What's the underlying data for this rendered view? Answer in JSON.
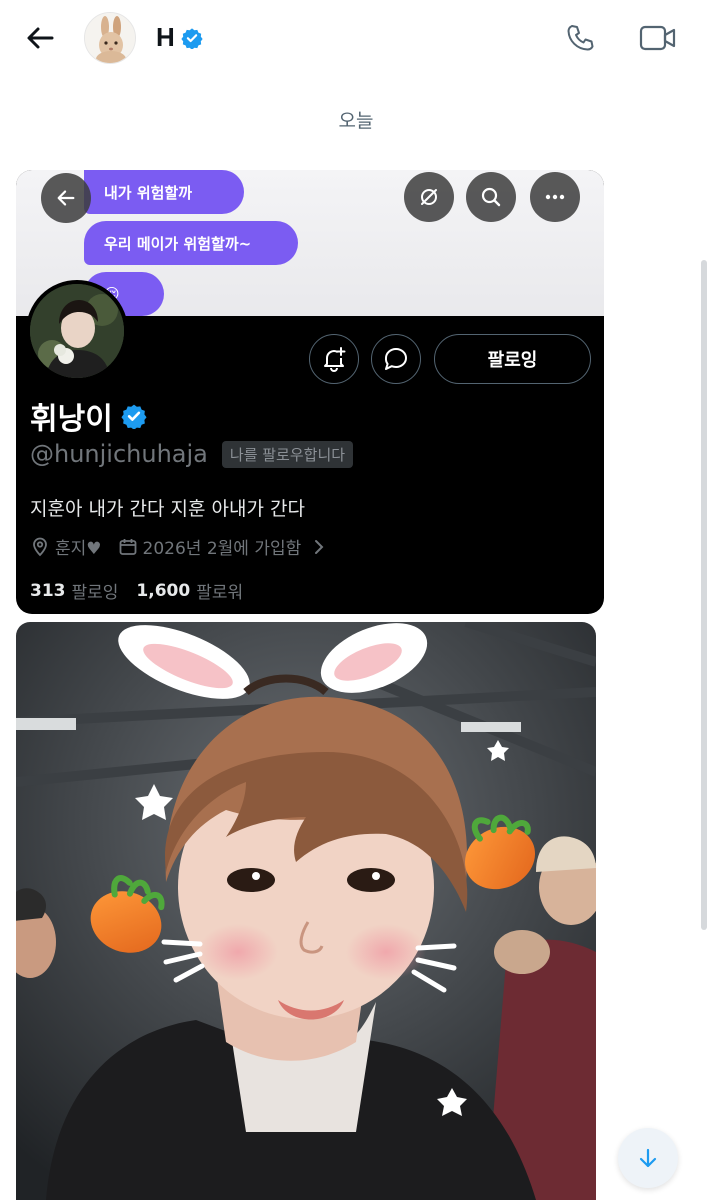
{
  "header": {
    "name": "H",
    "icons": {
      "back": "arrow-left-icon",
      "verified": "verified-badge-icon",
      "call": "phone-icon",
      "video": "video-camera-icon"
    }
  },
  "date_separator": "오늘",
  "shared_screenshot": {
    "chat_bubbles": [
      "내가 위험할까",
      "우리 메이가 위험할까~",
      "😔"
    ],
    "top_buttons": [
      "arrow-left-icon",
      "hide-icon",
      "search-icon",
      "more-icon"
    ],
    "profile": {
      "display_name": "휘낭이",
      "handle": "@hunjichuhaja",
      "follows_you_label": "나를 팔로우합니다",
      "follow_button_label": "팔로잉",
      "bio": "지훈아 내가 간다 지훈 아내가 간다",
      "location": "훈지♥",
      "joined": "2026년 2월에 가입함",
      "following_count": "313",
      "following_label": "팔로잉",
      "followers_count": "1,600",
      "followers_label": "팔로워"
    },
    "colors": {
      "bubble": "#7b5cf2",
      "verified": "#1d9bf0",
      "profile_bg": "#000000"
    }
  },
  "photo": {
    "description_icon": "photo-with-bunny-filter"
  },
  "scroll_down_icon": "arrow-down-icon"
}
